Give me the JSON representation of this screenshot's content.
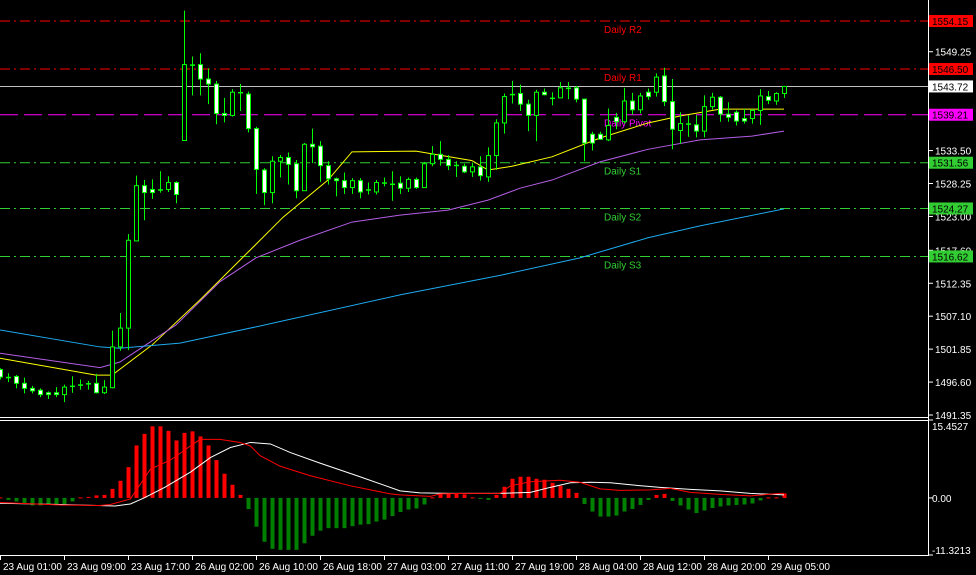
{
  "chart_data": {
    "type": "candlestick",
    "timeframe_hint": "H1",
    "colors": {
      "background": "#000000",
      "candle_outline": "#00ff00",
      "bear_fill": "#ffffff",
      "bull_fill": "#000000",
      "ma_fast": "#ffff00",
      "ma_mid": "#b45ee6",
      "ma_slow": "#1eaaf0",
      "resistance": "#ff0000",
      "pivot": "#ff00ff",
      "support": "#32cd32",
      "current_price": "#c0c0c0",
      "macd_pos": "#ff0000",
      "macd_neg": "#008000",
      "macd_main": "#ffffff",
      "macd_signal": "#ff0000",
      "axis": "#ffffff"
    },
    "price_axis": {
      "range": [
        1491.35,
        1554.15
      ],
      "ticks": [
        "1549.25",
        "1533.50",
        "1528.25",
        "1523.00",
        "1517.60",
        "1512.35",
        "1507.10",
        "1501.85",
        "1496.60",
        "1491.35"
      ]
    },
    "time_axis": {
      "labels": [
        {
          "i": 0,
          "t": "23 Aug 01:00"
        },
        {
          "i": 8,
          "t": "23 Aug 09:00"
        },
        {
          "i": 16,
          "t": "23 Aug 17:00"
        },
        {
          "i": 24,
          "t": "26 Aug 02:00"
        },
        {
          "i": 32,
          "t": "26 Aug 10:00"
        },
        {
          "i": 40,
          "t": "26 Aug 18:00"
        },
        {
          "i": 48,
          "t": "27 Aug 03:00"
        },
        {
          "i": 56,
          "t": "27 Aug 11:00"
        },
        {
          "i": 64,
          "t": "27 Aug 19:00"
        },
        {
          "i": 72,
          "t": "28 Aug 04:00"
        },
        {
          "i": 80,
          "t": "28 Aug 12:00"
        },
        {
          "i": 88,
          "t": "28 Aug 20:00"
        },
        {
          "i": 96,
          "t": "29 Aug 05:00"
        }
      ]
    },
    "current_price": {
      "value": 1543.72,
      "label": "1543.72"
    },
    "pivots": [
      {
        "name": "Daily R2",
        "value": 1554.15,
        "label": "1554.15",
        "kind": "resistance"
      },
      {
        "name": "Daily R1",
        "value": 1546.5,
        "label": "1546.50",
        "kind": "resistance"
      },
      {
        "name": "Daily Pivot",
        "value": 1539.21,
        "label": "1539.21",
        "kind": "pivot"
      },
      {
        "name": "Daily S1",
        "value": 1531.56,
        "label": "1531.56",
        "kind": "support"
      },
      {
        "name": "Daily S2",
        "value": 1524.27,
        "label": "1524.27",
        "kind": "support"
      },
      {
        "name": "Daily S3",
        "value": 1516.62,
        "label": "1516.62",
        "kind": "support"
      }
    ],
    "ohlc_fields": [
      "open",
      "high",
      "low",
      "close"
    ],
    "candles": [
      [
        1498.6,
        1498.8,
        1497.0,
        1497.4
      ],
      [
        1497.4,
        1498.0,
        1496.6,
        1497.4
      ],
      [
        1497.5,
        1497.7,
        1495.6,
        1496.4
      ],
      [
        1496.4,
        1497.3,
        1494.8,
        1495.6
      ],
      [
        1495.6,
        1496.0,
        1494.8,
        1495.2
      ],
      [
        1495.3,
        1495.6,
        1494.2,
        1494.6
      ],
      [
        1494.9,
        1495.1,
        1493.9,
        1494.6
      ],
      [
        1494.9,
        1495.8,
        1494.2,
        1494.6
      ],
      [
        1494.6,
        1496.2,
        1493.4,
        1495.8
      ],
      [
        1496.0,
        1497.5,
        1494.9,
        1496.0
      ],
      [
        1496.2,
        1497.0,
        1495.4,
        1496.2
      ],
      [
        1496.4,
        1496.8,
        1495.4,
        1496.4
      ],
      [
        1496.4,
        1497.9,
        1494.8,
        1494.9
      ],
      [
        1494.9,
        1496.9,
        1494.7,
        1495.8
      ],
      [
        1495.7,
        1504.8,
        1495.6,
        1502.2
      ],
      [
        1502.2,
        1507.6,
        1501.6,
        1505.2
      ],
      [
        1505.2,
        1520.2,
        1501.7,
        1519.2
      ],
      [
        1519.1,
        1529.5,
        1519.0,
        1527.9
      ],
      [
        1527.9,
        1528.8,
        1522.4,
        1526.8
      ],
      [
        1527.3,
        1528.9,
        1525.8,
        1526.8
      ],
      [
        1527.3,
        1530.2,
        1526.8,
        1527.3
      ],
      [
        1527.3,
        1529.4,
        1526.9,
        1528.4
      ],
      [
        1528.4,
        1528.6,
        1525.1,
        1526.5
      ],
      [
        1535.1,
        1555.8,
        1535.1,
        1547.2
      ],
      [
        1547.2,
        1548.5,
        1542.3,
        1547.2
      ],
      [
        1547.2,
        1549.0,
        1542.3,
        1544.9
      ],
      [
        1544.9,
        1546.6,
        1540.9,
        1544.1
      ],
      [
        1544.1,
        1544.6,
        1537.7,
        1539.4
      ],
      [
        1539.4,
        1541.9,
        1538.0,
        1539.1
      ],
      [
        1539.1,
        1543.3,
        1538.9,
        1542.8
      ],
      [
        1542.8,
        1544.1,
        1539.8,
        1542.8
      ],
      [
        1542.5,
        1542.9,
        1536.4,
        1537.0
      ],
      [
        1537.0,
        1537.3,
        1526.6,
        1530.5
      ],
      [
        1530.4,
        1530.7,
        1524.8,
        1526.8
      ],
      [
        1526.8,
        1532.6,
        1525.1,
        1531.8
      ],
      [
        1531.8,
        1532.8,
        1529.2,
        1532.4
      ],
      [
        1532.4,
        1533.2,
        1528.1,
        1531.3
      ],
      [
        1531.4,
        1532.0,
        1525.9,
        1527.1
      ],
      [
        1527.1,
        1534.7,
        1527.1,
        1534.5
      ],
      [
        1534.5,
        1537.0,
        1531.5,
        1534.1
      ],
      [
        1534.2,
        1535.0,
        1528.5,
        1531.1
      ],
      [
        1531.1,
        1531.8,
        1528.1,
        1529.0
      ],
      [
        1529.0,
        1529.2,
        1526.2,
        1528.7
      ],
      [
        1528.7,
        1530.0,
        1526.6,
        1527.6
      ],
      [
        1527.6,
        1529.1,
        1526.6,
        1528.7
      ],
      [
        1528.7,
        1529.1,
        1525.9,
        1526.9
      ],
      [
        1527.3,
        1528.4,
        1526.5,
        1527.3
      ],
      [
        1526.9,
        1528.8,
        1526.5,
        1528.4
      ],
      [
        1528.4,
        1529.2,
        1527.8,
        1528.4
      ],
      [
        1528.2,
        1530.2,
        1525.5,
        1528.2
      ],
      [
        1528.3,
        1529.4,
        1526.6,
        1527.5
      ],
      [
        1527.5,
        1529.2,
        1526.9,
        1528.9
      ],
      [
        1528.9,
        1529.2,
        1527.4,
        1527.6
      ],
      [
        1527.6,
        1531.7,
        1527.6,
        1531.4
      ],
      [
        1531.4,
        1534.2,
        1531.0,
        1532.9
      ],
      [
        1532.9,
        1535.0,
        1531.1,
        1532.1
      ],
      [
        1532.1,
        1532.8,
        1530.4,
        1531.1
      ],
      [
        1531.2,
        1531.8,
        1529.3,
        1531.2
      ],
      [
        1531.0,
        1531.4,
        1529.9,
        1530.1
      ],
      [
        1530.1,
        1531.6,
        1529.3,
        1530.9
      ],
      [
        1530.9,
        1532.6,
        1528.7,
        1529.5
      ],
      [
        1529.3,
        1534.0,
        1528.5,
        1532.7
      ],
      [
        1532.7,
        1538.5,
        1530.4,
        1537.9
      ],
      [
        1537.9,
        1542.6,
        1536.2,
        1542.1
      ],
      [
        1542.5,
        1544.6,
        1541.0,
        1542.5
      ],
      [
        1542.6,
        1544.0,
        1539.8,
        1540.9
      ],
      [
        1540.9,
        1541.6,
        1536.6,
        1539.1
      ],
      [
        1539.1,
        1543.2,
        1535.0,
        1542.8
      ],
      [
        1542.8,
        1543.4,
        1542.3,
        1542.4
      ],
      [
        1541.9,
        1542.8,
        1540.7,
        1541.9
      ],
      [
        1541.9,
        1544.4,
        1541.9,
        1543.5
      ],
      [
        1543.5,
        1544.4,
        1541.7,
        1543.5
      ],
      [
        1543.5,
        1543.8,
        1541.2,
        1541.7
      ],
      [
        1541.7,
        1541.8,
        1531.8,
        1534.7
      ],
      [
        1536.1,
        1536.5,
        1533.5,
        1534.7
      ],
      [
        1536.1,
        1536.5,
        1535.2,
        1535.3
      ],
      [
        1535.2,
        1540.2,
        1535.0,
        1537.5
      ],
      [
        1538.8,
        1539.5,
        1536.9,
        1538.1
      ],
      [
        1538.1,
        1543.5,
        1537.8,
        1541.4
      ],
      [
        1541.4,
        1542.7,
        1539.2,
        1540.0
      ],
      [
        1540.0,
        1542.7,
        1539.4,
        1542.2
      ],
      [
        1542.8,
        1543.4,
        1541.6,
        1542.1
      ],
      [
        1542.8,
        1545.8,
        1542.1,
        1545.2
      ],
      [
        1545.4,
        1546.7,
        1540.6,
        1541.3
      ],
      [
        1541.3,
        1544.9,
        1533.7,
        1536.9
      ],
      [
        1536.7,
        1539.6,
        1534.6,
        1537.8
      ],
      [
        1537.8,
        1539.1,
        1535.7,
        1537.8
      ],
      [
        1537.6,
        1539.1,
        1535.6,
        1536.6
      ],
      [
        1536.6,
        1542.3,
        1535.6,
        1540.5
      ],
      [
        1540.5,
        1542.7,
        1540.0,
        1542.0
      ],
      [
        1542.0,
        1542.2,
        1538.1,
        1539.3
      ],
      [
        1539.3,
        1541.2,
        1538.1,
        1538.8
      ],
      [
        1539.6,
        1539.9,
        1537.5,
        1538.2
      ],
      [
        1538.6,
        1540.1,
        1537.8,
        1538.2
      ],
      [
        1538.6,
        1540.1,
        1537.8,
        1539.9
      ],
      [
        1539.9,
        1543.3,
        1537.6,
        1542.2
      ],
      [
        1542.1,
        1543.0,
        1540.9,
        1541.5
      ],
      [
        1541.4,
        1542.8,
        1540.8,
        1542.6
      ],
      [
        1542.6,
        1543.8,
        1541.9,
        1543.72
      ]
    ],
    "moving_averages": [
      {
        "name": "ma-fast",
        "color_key": "ma_fast",
        "points": [
          [
            0,
            1500.4
          ],
          [
            12,
            1497.7
          ],
          [
            14,
            1497.7
          ],
          [
            19,
            1502.5
          ],
          [
            25,
            1509.7
          ],
          [
            32.5,
            1519.2
          ],
          [
            35.4,
            1522.9
          ],
          [
            41,
            1528.8
          ],
          [
            44,
            1533.3
          ],
          [
            52,
            1533.4
          ],
          [
            59,
            1531.9
          ],
          [
            61,
            1530.4
          ],
          [
            64,
            1531.0
          ],
          [
            69,
            1532.5
          ],
          [
            75,
            1535.5
          ],
          [
            81,
            1537.9
          ],
          [
            85,
            1539.0
          ],
          [
            90,
            1540.1
          ],
          [
            98,
            1540.1
          ]
        ]
      },
      {
        "name": "ma-mid",
        "color_key": "ma_mid",
        "points": [
          [
            0,
            1501.2
          ],
          [
            12.5,
            1498.9
          ],
          [
            15,
            1499.8
          ],
          [
            22,
            1505.7
          ],
          [
            27.5,
            1512.6
          ],
          [
            32,
            1516.4
          ],
          [
            37.5,
            1519.2
          ],
          [
            44,
            1522.1
          ],
          [
            50,
            1523.2
          ],
          [
            56,
            1524.0
          ],
          [
            61,
            1525.6
          ],
          [
            65,
            1527.5
          ],
          [
            69,
            1528.8
          ],
          [
            75,
            1531.7
          ],
          [
            81,
            1533.7
          ],
          [
            87.5,
            1535.2
          ],
          [
            94,
            1535.8
          ],
          [
            98,
            1536.6
          ]
        ]
      },
      {
        "name": "ma-slow",
        "color_key": "ma_slow",
        "points": [
          [
            0,
            1504.9
          ],
          [
            12.5,
            1502.2
          ],
          [
            15,
            1502.0
          ],
          [
            22.5,
            1502.8
          ],
          [
            32,
            1505.4
          ],
          [
            50,
            1510.5
          ],
          [
            62.5,
            1513.6
          ],
          [
            72.5,
            1516.4
          ],
          [
            81,
            1519.6
          ],
          [
            87.5,
            1521.5
          ],
          [
            98,
            1524.2
          ]
        ]
      }
    ],
    "macd": {
      "range": [
        -11.3213,
        15.4527
      ],
      "tick_labels": [
        "15.4527",
        "0.00",
        "-11.3213"
      ],
      "tick_values": [
        15.4527,
        0,
        -11.3213
      ],
      "histogram": [
        0.1,
        -0.4,
        -0.7,
        -1.0,
        -1.5,
        -1.5,
        -1.4,
        -1.3,
        -1.2,
        -0.7,
        0.1,
        0.2,
        0.5,
        0.6,
        1.8,
        3.4,
        6.1,
        10.4,
        12.7,
        14.2,
        14.2,
        13.3,
        11.4,
        12.9,
        13.2,
        12.2,
        10.4,
        7.5,
        4.8,
        2.6,
        0.6,
        -2.2,
        -5.7,
        -8.7,
        -10.1,
        -10.3,
        -10.3,
        -10.3,
        -9.0,
        -7.5,
        -6.5,
        -6.0,
        -6.0,
        -6.0,
        -5.6,
        -5.3,
        -5.2,
        -4.7,
        -4.3,
        -3.6,
        -2.8,
        -2.3,
        -2.1,
        -1.3,
        0.1,
        0.9,
        0.9,
        0.9,
        0.7,
        0.1,
        -0.1,
        -0.4,
        0.6,
        2.2,
        3.8,
        4.2,
        4.2,
        3.8,
        3.6,
        3.0,
        2.4,
        1.8,
        1.0,
        -1.2,
        -2.7,
        -3.7,
        -3.7,
        -3.5,
        -2.7,
        -2.2,
        -1.4,
        -0.4,
        0.6,
        0.8,
        -0.6,
        -1.5,
        -2.3,
        -3.0,
        -2.5,
        -2.0,
        -1.7,
        -1.5,
        -1.4,
        -1.3,
        -1.1,
        -0.5,
        0.1,
        0.1,
        0.9
      ],
      "main": [
        [
          0,
          -1.05
        ],
        [
          7.5,
          -1.3
        ],
        [
          14.4,
          -1.6
        ],
        [
          16.3,
          -1.2
        ],
        [
          18,
          0
        ],
        [
          20.6,
          2.1
        ],
        [
          23.8,
          5.1
        ],
        [
          26.3,
          8.0
        ],
        [
          28.8,
          10.0
        ],
        [
          31.3,
          11.0
        ],
        [
          33.8,
          10.7
        ],
        [
          36.3,
          9.0
        ],
        [
          40,
          6.9
        ],
        [
          45,
          4.2
        ],
        [
          50,
          1.4
        ],
        [
          52.5,
          1.0
        ],
        [
          56.3,
          0.9
        ],
        [
          62.5,
          0.9
        ],
        [
          66.3,
          1.1
        ],
        [
          68.8,
          2.1
        ],
        [
          71.3,
          3.0
        ],
        [
          73.8,
          3.1
        ],
        [
          76.3,
          3.0
        ],
        [
          78.8,
          2.6
        ],
        [
          82.5,
          2.1
        ],
        [
          86.3,
          1.7
        ],
        [
          90,
          1.4
        ],
        [
          93.8,
          0.9
        ],
        [
          98,
          0.6
        ]
      ],
      "signal": [
        [
          0,
          -0.9
        ],
        [
          7.5,
          -1.4
        ],
        [
          12.5,
          -1.5
        ],
        [
          13.8,
          -1.3
        ],
        [
          16.3,
          -0.2
        ],
        [
          18.8,
          5.7
        ],
        [
          21.3,
          7.5
        ],
        [
          23.8,
          10.3
        ],
        [
          25,
          11.6
        ],
        [
          27.5,
          11.6
        ],
        [
          30,
          11.0
        ],
        [
          31.3,
          10.3
        ],
        [
          32.5,
          8.4
        ],
        [
          35,
          6.3
        ],
        [
          38.8,
          4.4
        ],
        [
          43.8,
          2.4
        ],
        [
          48.8,
          0.8
        ],
        [
          50,
          0.6
        ],
        [
          53.8,
          0.3
        ],
        [
          55,
          0.8
        ],
        [
          58,
          0.9
        ],
        [
          62.5,
          0.9
        ],
        [
          63.8,
          2.4
        ],
        [
          66.3,
          3.2
        ],
        [
          70,
          3.5
        ],
        [
          72.5,
          3.1
        ],
        [
          75,
          1.8
        ],
        [
          77.5,
          1.5
        ],
        [
          81.3,
          1.6
        ],
        [
          83.8,
          1.9
        ],
        [
          86.3,
          1.1
        ],
        [
          90,
          0.7
        ],
        [
          93.8,
          0.4
        ],
        [
          97.5,
          0.9
        ],
        [
          98,
          0.9
        ]
      ]
    }
  }
}
